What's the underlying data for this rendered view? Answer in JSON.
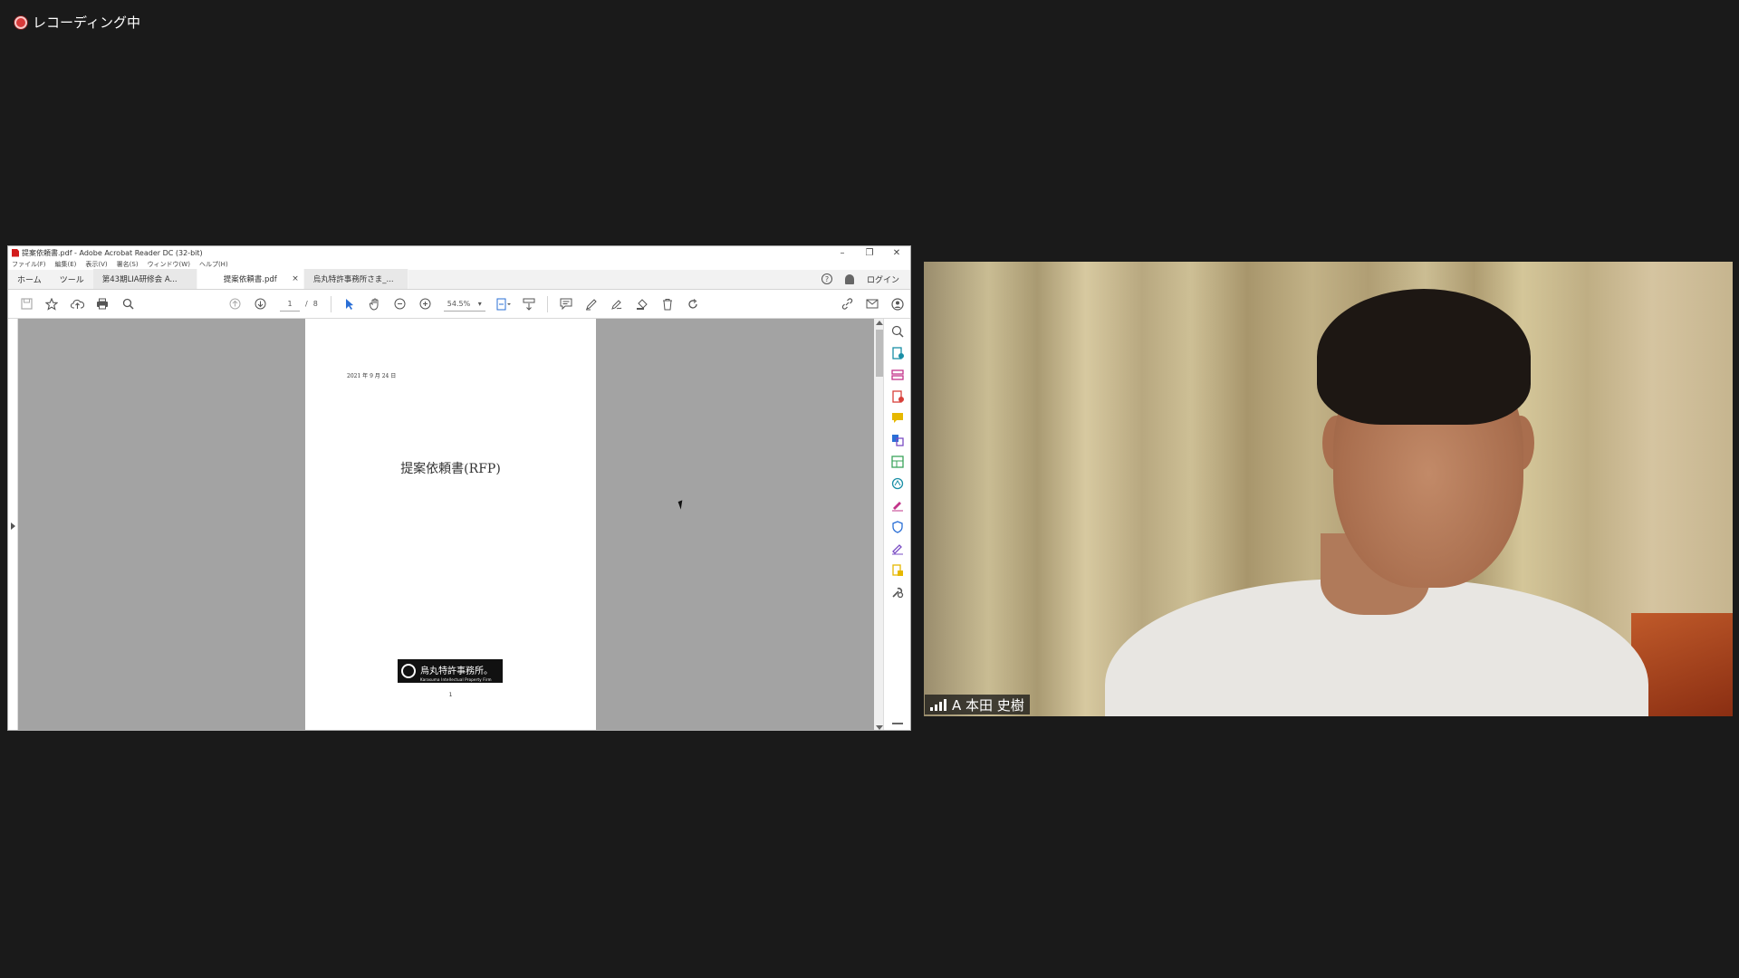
{
  "recording": {
    "label": "レコーディング中"
  },
  "acrobat": {
    "window_title": "提案依頼書.pdf - Adobe Acrobat Reader DC (32-bit)",
    "window_controls": [
      "–",
      "❐",
      "✕"
    ],
    "menu": [
      "ファイル(F)",
      "編集(E)",
      "表示(V)",
      "署名(S)",
      "ウィンドウ(W)",
      "ヘルプ(H)"
    ],
    "tabs": {
      "home": "ホーム",
      "tools": "ツール",
      "doc1": "第43期LIA研修会 A...",
      "doc2": "提案依頼書.pdf",
      "doc2_close": "×",
      "doc3": "烏丸特許事務所さま_..."
    },
    "help_icon": "?",
    "login": "ログイン",
    "page": {
      "current": "1",
      "separator": "/",
      "total": "8"
    },
    "zoom": {
      "value": "54.5%",
      "caret": "▾"
    },
    "document": {
      "date": "2021 年 9 月 24 日",
      "title": "提案依頼書(RFP)",
      "logo_name": "烏丸特許事務所。",
      "logo_sub": "Karasuma Intellectual Property Firm",
      "page_number": "1"
    },
    "accent_colors": {
      "blue": "#2a6fd6",
      "red": "#d8403a",
      "yellow": "#e6b800",
      "green": "#3aa35a",
      "teal": "#1a8fa6",
      "magenta": "#c2348a",
      "purple": "#7a4cc4"
    }
  },
  "participant": {
    "name": "A 本田 史樹",
    "signal_icon": "signal-bars-icon"
  }
}
